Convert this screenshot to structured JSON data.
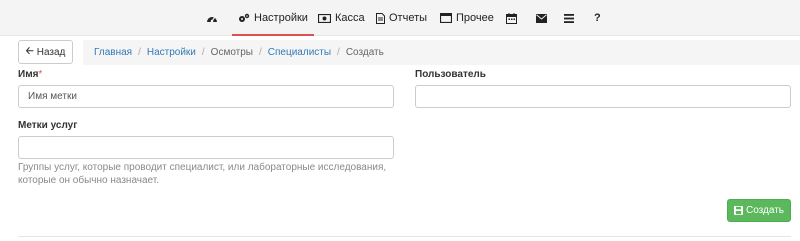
{
  "topnav": {
    "dashboard_icon": "dashboard-icon",
    "settings_label": "Настройки",
    "kassa_label": "Касса",
    "reports_label": "Отчеты",
    "other_label": "Прочее",
    "help_label": "?",
    "active_color": "#d9534f"
  },
  "toolbar": {
    "back_label": "Назад",
    "breadcrumb": {
      "home": "Главная",
      "settings": "Настройки",
      "inspections": "Осмотры",
      "specialists": "Специалисты",
      "current": "Создать",
      "separator": "/"
    }
  },
  "form": {
    "name": {
      "label": "Имя",
      "required_mark": "*",
      "placeholder": "Имя метки",
      "value": ""
    },
    "user": {
      "label": "Пользователь",
      "value": ""
    },
    "service_tags": {
      "label": "Метки услуг",
      "value": "",
      "help": "Группы услуг, которые проводит специалист, или лабораторные исследования, которые он обычно назначает."
    },
    "create_label": "Создать",
    "create_color": "#5cb85c"
  }
}
